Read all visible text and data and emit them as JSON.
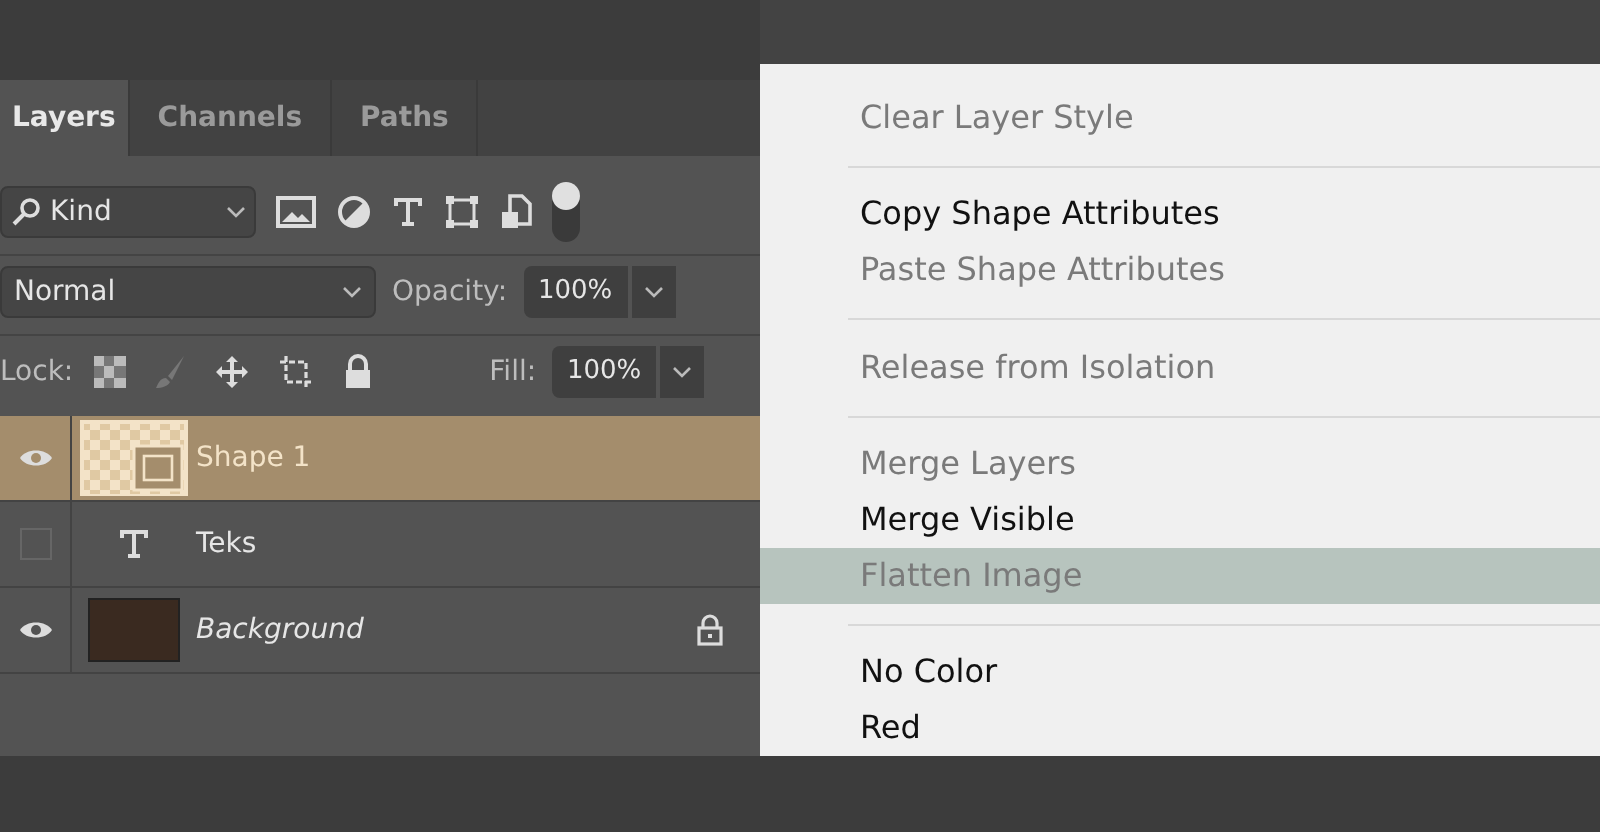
{
  "tabs": [
    {
      "label": "Layers",
      "selected": true
    },
    {
      "label": "Channels",
      "selected": false
    },
    {
      "label": "Paths",
      "selected": false
    }
  ],
  "filter": {
    "value": "Kind",
    "on": true
  },
  "blend_mode": "Normal",
  "opacity_label": "Opacity:",
  "opacity": "100%",
  "lock_label": "Lock:",
  "fill_label": "Fill:",
  "fill": "100%",
  "layers": [
    {
      "name": "Shape 1",
      "kind": "shape",
      "visible": true,
      "selected": true,
      "locked": false
    },
    {
      "name": "Teks",
      "kind": "text",
      "visible": false,
      "selected": false,
      "locked": false
    },
    {
      "name": "Background",
      "kind": "background",
      "visible": true,
      "selected": false,
      "locked": true
    }
  ],
  "menu": [
    {
      "kind": "item",
      "label": "Clear Layer Style",
      "disabled": true,
      "selected": false
    },
    {
      "kind": "separator"
    },
    {
      "kind": "item",
      "label": "Copy Shape Attributes",
      "disabled": false,
      "selected": false
    },
    {
      "kind": "item",
      "label": "Paste Shape Attributes",
      "disabled": true,
      "selected": false
    },
    {
      "kind": "separator"
    },
    {
      "kind": "item",
      "label": "Release from Isolation",
      "disabled": true,
      "selected": false
    },
    {
      "kind": "separator"
    },
    {
      "kind": "item",
      "label": "Merge Layers",
      "disabled": true,
      "selected": false
    },
    {
      "kind": "item",
      "label": "Merge Visible",
      "disabled": false,
      "selected": false
    },
    {
      "kind": "item",
      "label": "Flatten Image",
      "disabled": true,
      "selected": true
    },
    {
      "kind": "separator"
    },
    {
      "kind": "item",
      "label": "No Color",
      "disabled": false,
      "selected": false
    },
    {
      "kind": "item",
      "label": "Red",
      "disabled": false,
      "selected": false
    }
  ]
}
